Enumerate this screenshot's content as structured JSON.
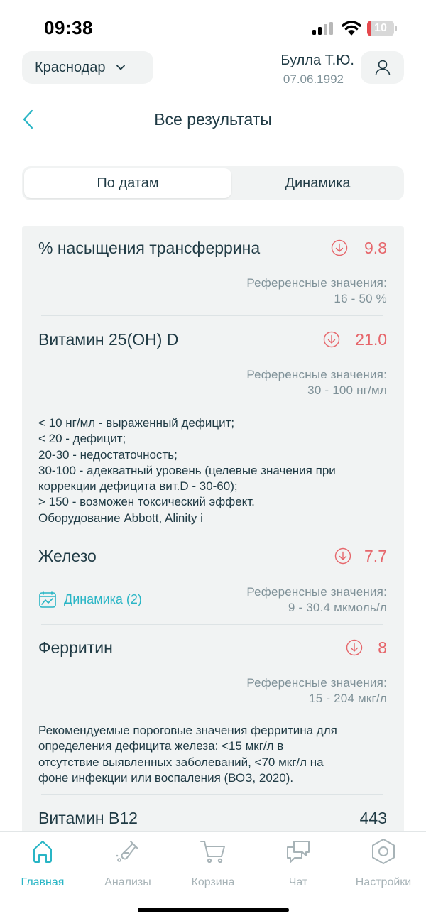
{
  "status_bar": {
    "time": "09:38",
    "battery": "10",
    "colors": {
      "battery_low": "#e5484d"
    }
  },
  "header": {
    "city": "Краснодар",
    "user_name": "Булла Т.Ю.",
    "user_dob": "07.06.1992",
    "title": "Все результаты"
  },
  "tabs": {
    "by_dates": "По датам",
    "dynamics": "Динамика",
    "active": "by_dates"
  },
  "results": [
    {
      "name": "% насыщения трансферрина",
      "value": "9.8",
      "status": "low",
      "status_icon": "arrow-down-circle-icon",
      "reference_label": "Референсные значения:",
      "reference_range": "16 - 50 %"
    },
    {
      "name": "Витамин 25(ОН) D",
      "value": "21.0",
      "status": "low",
      "status_icon": "arrow-down-circle-icon",
      "reference_label": "Референсные значения:",
      "reference_range": "30 - 100 нг/мл",
      "note_lines": [
        "< 10 нг/мл - выраженный дефицит;",
        "< 20 - дефицит;",
        "20-30 - недостаточность;",
        "30-100 - адекватный уровень (целевые значения при",
        "коррекции дефицита вит.D - 30-60);",
        "> 150 - возможен токсический эффект.",
        "Оборудование Abbott, Alinity i"
      ]
    },
    {
      "name": "Железо",
      "value": "7.7",
      "status": "low",
      "status_icon": "arrow-down-circle-icon",
      "dynamics_link": "Динамика (2)",
      "reference_label": "Референсные значения:",
      "reference_range": "9 - 30.4 мкмоль/л"
    },
    {
      "name": "Ферритин",
      "value": "8",
      "status": "low",
      "status_icon": "arrow-down-circle-icon",
      "reference_label": "Референсные значения:",
      "reference_range": "15 - 204 мкг/л",
      "note_lines": [
        "Рекомендуемые пороговые значения ферритина для",
        "определения дефицита железа: <15 мкг/л в",
        "отсутствие выявленных заболеваний, <70 мкг/л на",
        "фоне инфекции или воспаления (ВОЗ, 2020)."
      ]
    },
    {
      "name": "Витамин В12",
      "value": "443",
      "status": "normal"
    }
  ],
  "tabbar": [
    {
      "label": "Главная",
      "icon": "home-icon",
      "active": true
    },
    {
      "label": "Анализы",
      "icon": "test-tube-icon",
      "active": false
    },
    {
      "label": "Корзина",
      "icon": "cart-icon",
      "active": false
    },
    {
      "label": "Чат",
      "icon": "chat-icon",
      "active": false
    },
    {
      "label": "Настройки",
      "icon": "settings-icon",
      "active": false
    }
  ],
  "colors": {
    "accent": "#29b5c5",
    "low_value": "#e6666b",
    "text_primary": "#1f3a44",
    "text_secondary": "#7f9198",
    "card_background": "#f1f3f3"
  }
}
